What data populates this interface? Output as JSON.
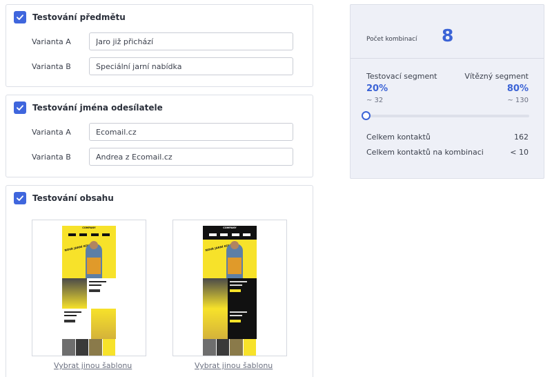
{
  "colors": {
    "accent": "#3b63d6",
    "checkbox": "#3f66dd",
    "email_yellow": "#f7e22a",
    "email_dark": "#111111",
    "panel_bg": "#eef0f7"
  },
  "subject_test": {
    "checked": true,
    "title": "Testování předmětu",
    "variants": [
      {
        "label": "Varianta A",
        "value": "Jaro již přichází"
      },
      {
        "label": "Varianta B",
        "value": "Speciální jarní nabídka"
      }
    ]
  },
  "sender_test": {
    "checked": true,
    "title": "Testování jména odesílatele",
    "variants": [
      {
        "label": "Varianta A",
        "value": "Ecomail.cz"
      },
      {
        "label": "Varianta B",
        "value": "Andrea z Ecomail.cz"
      }
    ]
  },
  "content_test": {
    "checked": true,
    "title": "Testování obsahu",
    "templates": [
      {
        "theme": "light",
        "company": "COMPANY",
        "headline": "NOVÁ JARNÍ KOLEKCE",
        "link": "Vybrat jinou šablonu"
      },
      {
        "theme": "dark",
        "company": "COMPANY",
        "headline": "NOVÁ JARNÍ KOLEKCE",
        "link": "Vybrat jinou šablonu"
      }
    ]
  },
  "summary": {
    "combinations_label": "Počet kombinací",
    "combinations_value": "8",
    "test_segment_label": "Testovací segment",
    "winner_segment_label": "Vítězný segment",
    "test_segment_percent": "20%",
    "winner_segment_percent": "80%",
    "test_segment_approx": "~ 32",
    "winner_segment_approx": "~ 130",
    "slider_value_percent": 20,
    "total_contacts_label": "Celkem kontaktů",
    "total_contacts_value": "162",
    "per_combination_label": "Celkem kontaktů na kombinaci",
    "per_combination_value": "< 10"
  }
}
